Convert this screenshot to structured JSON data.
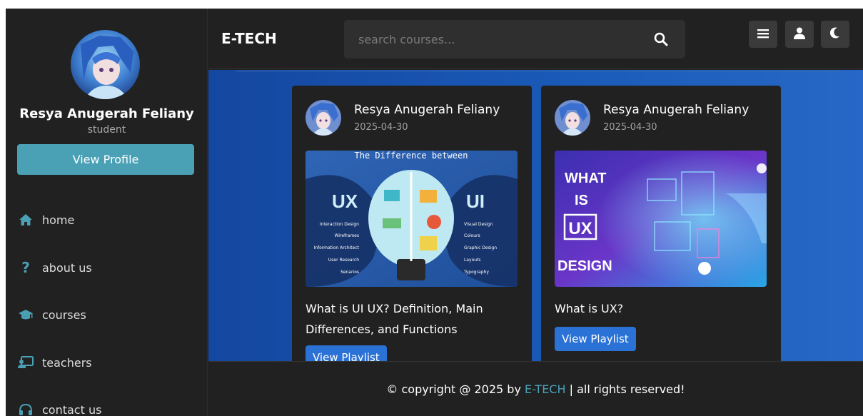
{
  "sidebar": {
    "user_name": "Resya Anugerah Feliany",
    "user_role": "student",
    "view_profile_label": "View Profile",
    "nav": [
      {
        "label": "home",
        "icon": "home-icon"
      },
      {
        "label": "about us",
        "icon": "question-icon"
      },
      {
        "label": "courses",
        "icon": "graduation-cap-icon"
      },
      {
        "label": "teachers",
        "icon": "chalkboard-teacher-icon"
      },
      {
        "label": "contact us",
        "icon": "headset-icon"
      }
    ]
  },
  "header": {
    "logo": "E-TECH",
    "search_placeholder": "search courses...",
    "buttons": [
      "menu-icon",
      "user-icon",
      "moon-icon"
    ]
  },
  "cards": [
    {
      "author": "Resya Anugerah Feliany",
      "date": "2025-04-30",
      "title": "What is UI UX? Definition, Main Differences, and Functions",
      "button": "View Playlist",
      "thumb": {
        "heading": "The Difference between",
        "left_label": "UX",
        "right_label": "UI",
        "left_items": [
          "Interaction Design",
          "Wireframes",
          "Information Architect",
          "User Research",
          "Senarios"
        ],
        "right_items": [
          "Visual Design",
          "Colours",
          "Graphic Design",
          "Layouts",
          "Typography"
        ]
      }
    },
    {
      "author": "Resya Anugerah Feliany",
      "date": "2025-04-30",
      "title": "What is UX?",
      "button": "View Playlist",
      "thumb": {
        "line1": "WHAT",
        "line2": "IS",
        "line3": "UX",
        "line4": "DESIGN"
      }
    }
  ],
  "footer": {
    "prefix": "© copyright @ 2025 by ",
    "brand": "E-TECH",
    "suffix": " | all rights reserved!"
  },
  "colors": {
    "accent": "#4aa0b5",
    "button_blue": "#2b72d6",
    "main_bg": "#1a55b3",
    "panel": "#212121"
  }
}
